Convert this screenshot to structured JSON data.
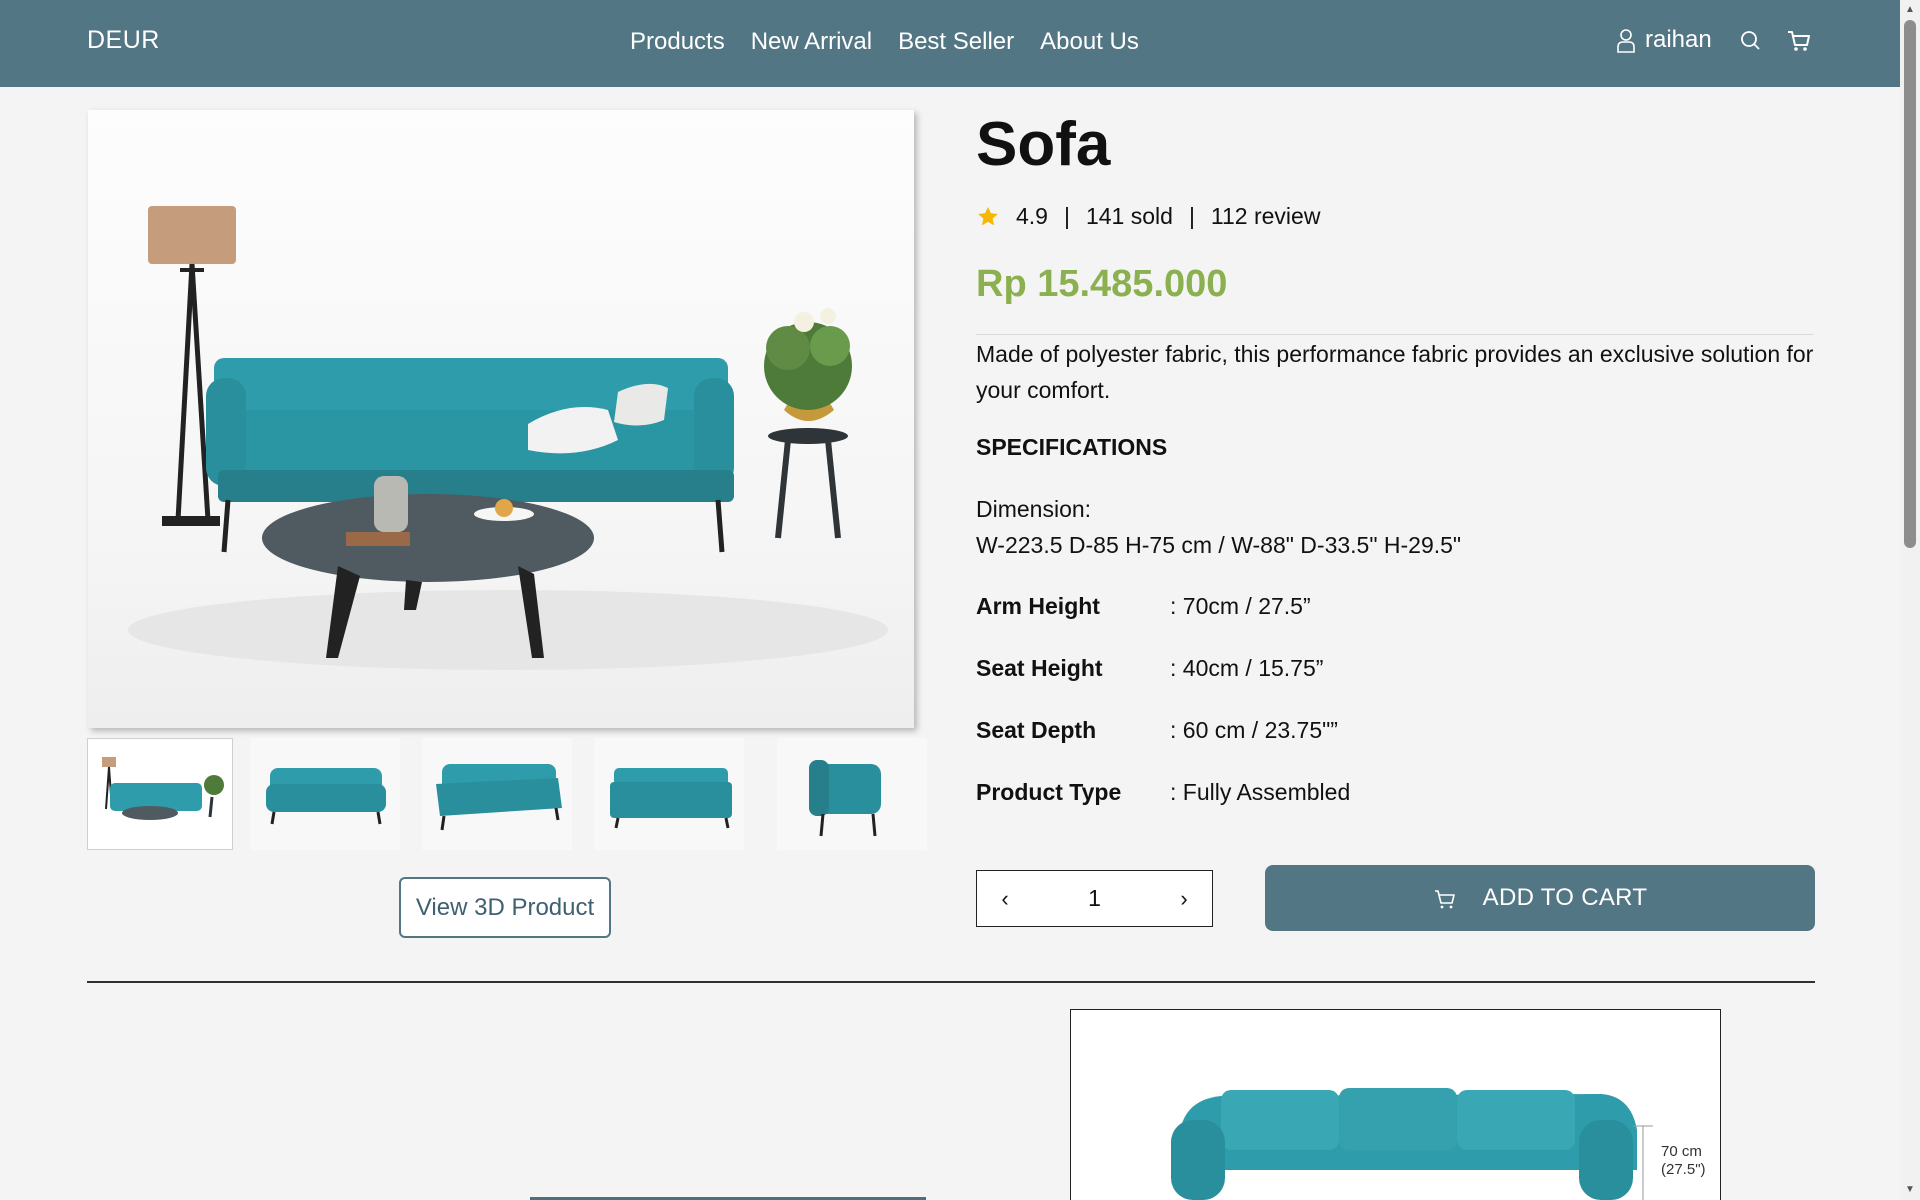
{
  "nav": {
    "brand": "DEUR",
    "links": [
      "Products",
      "New Arrival",
      "Best Seller",
      "About Us"
    ],
    "username": "raihan",
    "icons": [
      "user-icon",
      "search-icon",
      "cart-icon"
    ]
  },
  "gallery": {
    "thumbnail_count": 5,
    "active_thumbnail": 1,
    "view3d_label": "View 3D Product"
  },
  "product": {
    "title": "Sofa",
    "rating": "4.9",
    "sold": "141 sold",
    "reviews": "112 review",
    "separator": "|",
    "price": "Rp 15.485.000",
    "description": "Made of polyester fabric, this performance fabric provides an exclusive solution for your comfort.",
    "spec_heading": "SPECIFICATIONS",
    "dimension_label": "Dimension:",
    "dimension_value": "W-223.5 D-85 H-75 cm / W-88\" D-33.5\" H-29.5\"",
    "specs": [
      {
        "key": "Arm Height",
        "value": ": 70cm / 27.5”"
      },
      {
        "key": "Seat Height",
        "value": ": 40cm / 15.75”"
      },
      {
        "key": "Seat Depth",
        "value": ": 60 cm / 23.75\"”"
      },
      {
        "key": "Product Type",
        "value": ": Fully Assembled"
      }
    ]
  },
  "cart": {
    "quantity": "1",
    "decrement": "‹",
    "increment": "›",
    "add_label": "ADD TO CART"
  },
  "dimension_figure": {
    "label_line1": "70 cm",
    "label_line2": "(27.5\")"
  },
  "colors": {
    "nav_bg": "#537684",
    "price": "#8bb04f",
    "sofa": "#2e9caa",
    "star": "#f5b800"
  }
}
